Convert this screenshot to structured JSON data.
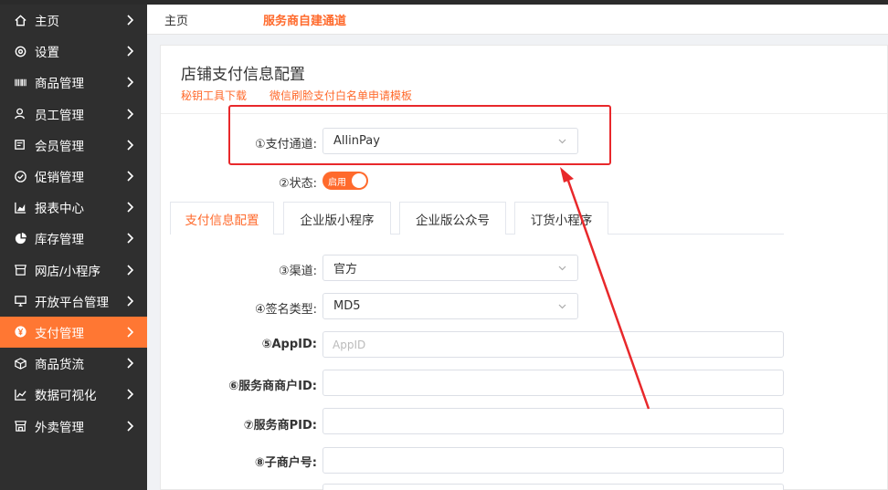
{
  "sidebar": {
    "items": [
      {
        "label": "主页",
        "icon": "home-icon"
      },
      {
        "label": "设置",
        "icon": "gear-icon"
      },
      {
        "label": "商品管理",
        "icon": "barcode-icon"
      },
      {
        "label": "员工管理",
        "icon": "user-icon"
      },
      {
        "label": "会员管理",
        "icon": "member-card-icon"
      },
      {
        "label": "促销管理",
        "icon": "check-circle-icon"
      },
      {
        "label": "报表中心",
        "icon": "chart-icon"
      },
      {
        "label": "库存管理",
        "icon": "pie-icon"
      },
      {
        "label": "网店/小程序",
        "icon": "shop-icon"
      },
      {
        "label": "开放平台管理",
        "icon": "monitor-icon"
      },
      {
        "label": "支付管理",
        "icon": "yuan-icon",
        "active": true
      },
      {
        "label": "商品货流",
        "icon": "cube-icon"
      },
      {
        "label": "数据可视化",
        "icon": "line-chart-icon"
      },
      {
        "label": "外卖管理",
        "icon": "store-icon"
      }
    ],
    "active_color": "#ff7733"
  },
  "breadcrumb": {
    "home": "主页",
    "current": "服务商自建通道"
  },
  "panel": {
    "title": "店铺支付信息配置",
    "links": [
      "秘钥工具下载",
      "微信刷脸支付白名单申请模板"
    ]
  },
  "form": {
    "channel": {
      "label": "①支付通道:",
      "value": "AllinPay"
    },
    "status": {
      "label": "②状态:",
      "toggle_text": "启用",
      "on": true
    },
    "tabs": [
      {
        "label": "支付信息配置",
        "active": true
      },
      {
        "label": "企业版小程序"
      },
      {
        "label": "企业版公众号"
      },
      {
        "label": "订货小程序"
      }
    ],
    "route": {
      "label": "③渠道:",
      "value": "官方"
    },
    "sign_type": {
      "label": "④签名类型:",
      "value": "MD5"
    },
    "appid": {
      "label": "⑤AppID:",
      "value": "",
      "placeholder": "AppID"
    },
    "merchant_id": {
      "label": "⑥服务商商户ID:",
      "value": ""
    },
    "pid": {
      "label": "⑦服务商PID:",
      "value": ""
    },
    "sub_merchant": {
      "label": "⑧子商户号:",
      "value": ""
    }
  },
  "colors": {
    "accent": "#ff6a2c",
    "annotation": "#e8282b"
  }
}
